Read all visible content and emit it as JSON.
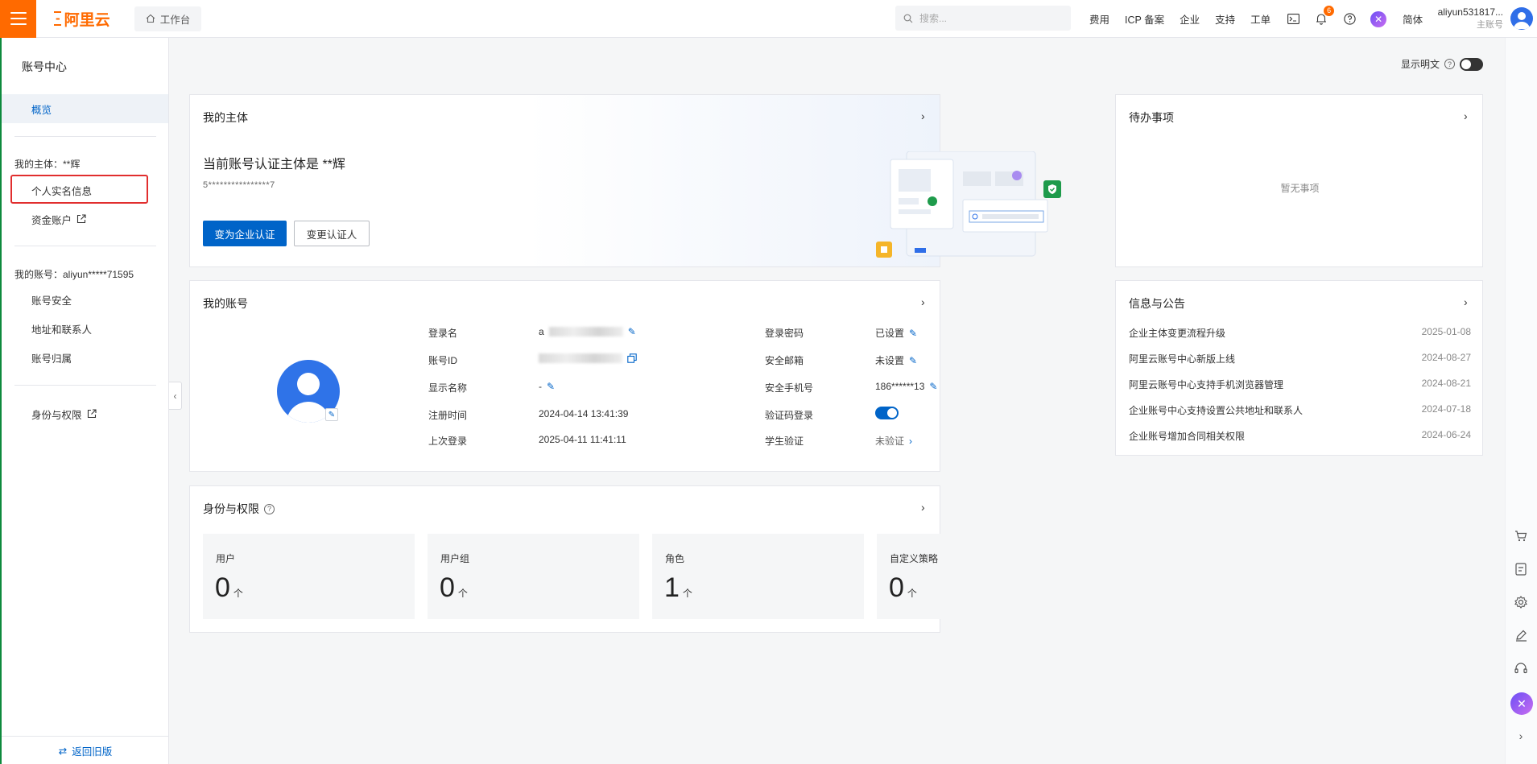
{
  "header": {
    "brand": "阿里云",
    "workbench": "工作台",
    "search_placeholder": "搜索...",
    "nav": [
      "费用",
      "ICP 备案",
      "企业",
      "支持",
      "工单"
    ],
    "notification_count": "6",
    "language": "简体",
    "username": "aliyun531817...",
    "account_type": "主账号"
  },
  "sidebar": {
    "title": "账号中心",
    "overview": "概览",
    "subject_section": "我的主体：**辉",
    "personal_realname": "个人实名信息",
    "fund_account": "资金账户",
    "account_section": "我的账号：aliyun*****71595",
    "account_security": "账号安全",
    "address_contacts": "地址和联系人",
    "account_ownership": "账号归属",
    "identity_permissions": "身份与权限",
    "back_old": "返回旧版"
  },
  "display_plaintext": "显示明文",
  "subject_card": {
    "title": "我的主体",
    "line": "当前账号认证主体是 **辉",
    "masked_id": "5****************7",
    "primary_button": "变为企业认证",
    "secondary_button": "变更认证人"
  },
  "todo_card": {
    "title": "待办事项",
    "empty": "暂无事项"
  },
  "account_card": {
    "title": "我的账号",
    "login_name_label": "登录名",
    "login_name_value": "a",
    "account_id_label": "账号ID",
    "display_name_label": "显示名称",
    "display_name_value": "-",
    "register_time_label": "注册时间",
    "register_time_value": "2024-04-14 13:41:39",
    "last_login_label": "上次登录",
    "last_login_value": "2025-04-11 11:41:11",
    "password_label": "登录密码",
    "password_value": "已设置",
    "email_label": "安全邮箱",
    "email_value": "未设置",
    "phone_label": "安全手机号",
    "phone_value": "186******13",
    "sms_login_label": "验证码登录",
    "student_label": "学生验证",
    "student_value": "未验证"
  },
  "notice_card": {
    "title": "信息与公告",
    "items": [
      {
        "text": "企业主体变更流程升级",
        "date": "2025-01-08"
      },
      {
        "text": "阿里云账号中心新版上线",
        "date": "2024-08-27"
      },
      {
        "text": "阿里云账号中心支持手机浏览器管理",
        "date": "2024-08-21"
      },
      {
        "text": "企业账号中心支持设置公共地址和联系人",
        "date": "2024-07-18"
      },
      {
        "text": "企业账号增加合同相关权限",
        "date": "2024-06-24"
      }
    ]
  },
  "perm_card": {
    "title": "身份与权限",
    "unit": "个",
    "stats": [
      {
        "label": "用户",
        "value": "0"
      },
      {
        "label": "用户组",
        "value": "0"
      },
      {
        "label": "角色",
        "value": "1"
      },
      {
        "label": "自定义策略",
        "value": "0"
      }
    ]
  },
  "colors": {
    "brand": "#ff6a00",
    "primary": "#0064c8",
    "highlight": "#e12e2e"
  }
}
